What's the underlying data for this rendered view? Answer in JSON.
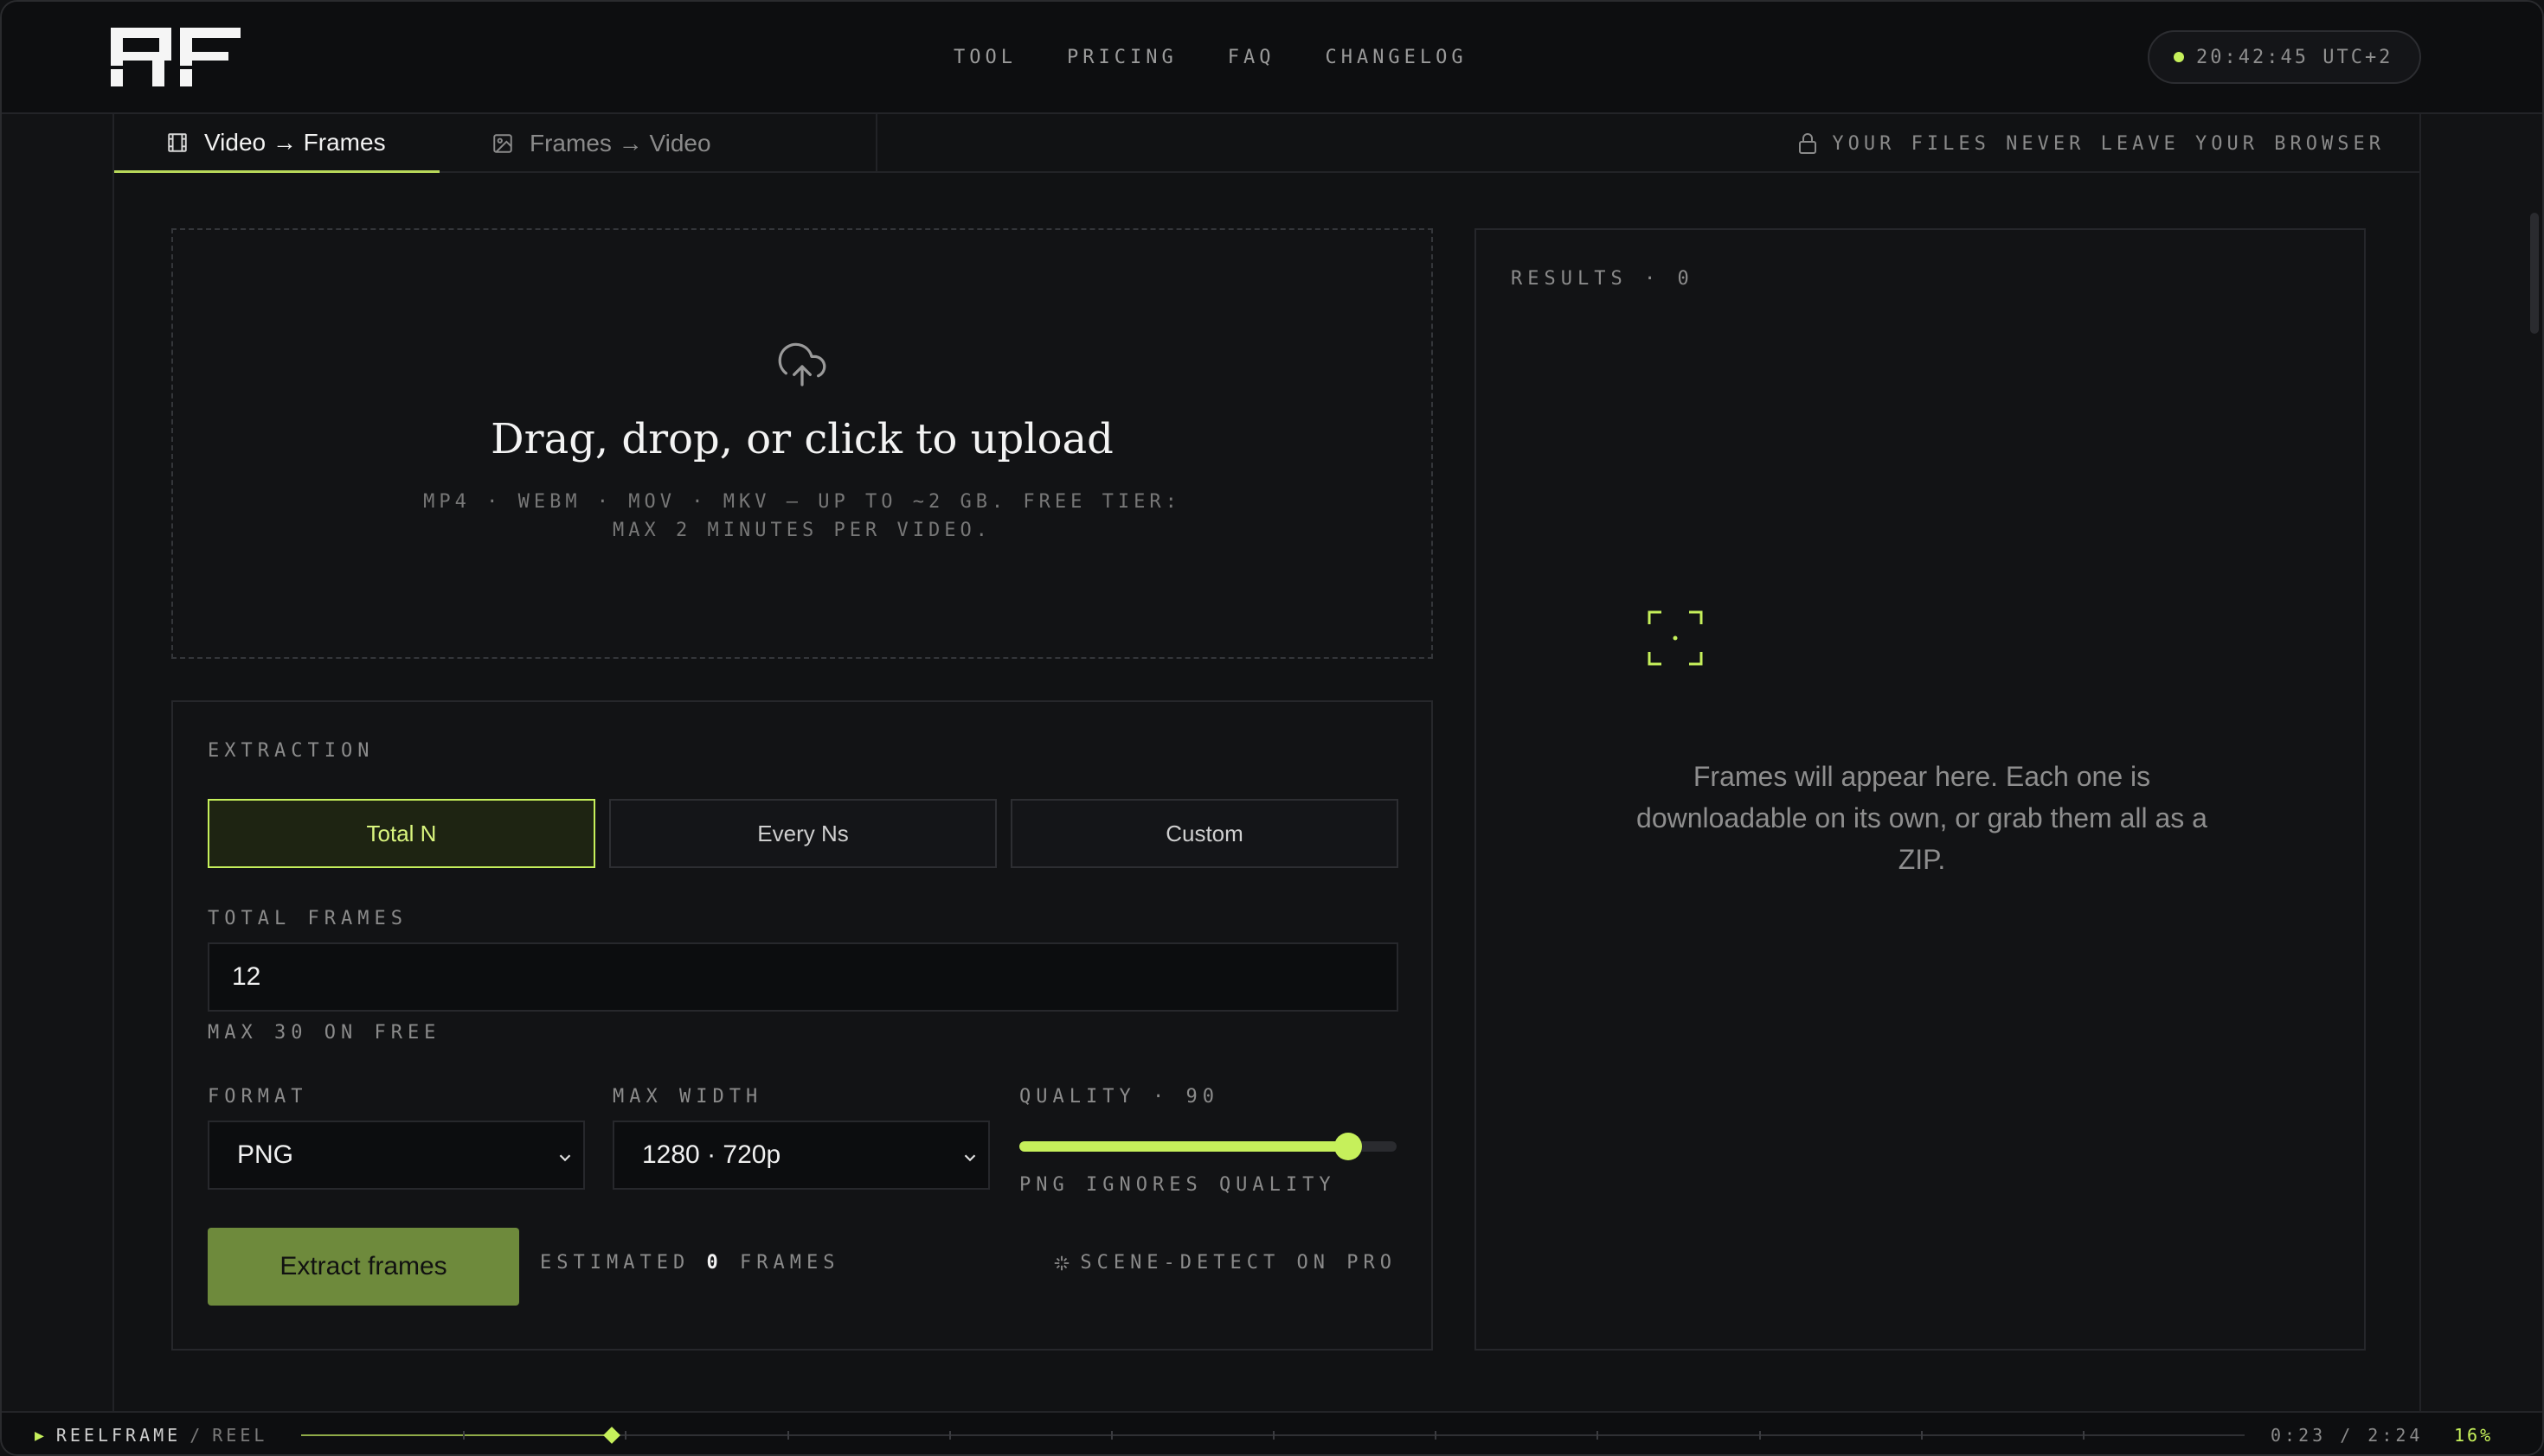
{
  "header": {
    "logo_text": "RF",
    "nav": [
      "TOOL",
      "PRICING",
      "FAQ",
      "CHANGELOG"
    ],
    "clock": "20:42:45 UTC+2"
  },
  "tabs": [
    {
      "label": "Video → Frames",
      "icon": "film-icon"
    },
    {
      "label": "Frames → Video",
      "icon": "image-icon"
    }
  ],
  "privacy_note": "YOUR FILES NEVER LEAVE YOUR BROWSER",
  "upload": {
    "title": "Drag, drop, or click to upload",
    "subtitle": "MP4 · WEBM · MOV · MKV — UP TO ~2 GB. FREE TIER: MAX 2 MINUTES PER VIDEO."
  },
  "extraction": {
    "section_label": "EXTRACTION",
    "modes": [
      "Total N",
      "Every Ns",
      "Custom"
    ],
    "selected_mode": "Total N",
    "total_frames_label": "TOTAL FRAMES",
    "total_frames_value": "12",
    "total_frames_hint": "MAX 30 ON FREE",
    "format_label": "FORMAT",
    "format_value": "PNG",
    "max_width_label": "MAX WIDTH",
    "max_width_value": "1280 · 720p",
    "quality_label": "QUALITY · 90",
    "quality_value": 90,
    "quality_hint": "PNG IGNORES QUALITY",
    "extract_button": "Extract frames",
    "estimated_prefix": "ESTIMATED",
    "estimated_count": "0",
    "estimated_suffix": "FRAMES",
    "scene_detect": "SCENE-DETECT ON PRO"
  },
  "results": {
    "label": "RESULTS · 0",
    "empty_text": "Frames will appear here. Each one is downloadable on its own, or grab them all as a ZIP."
  },
  "timeline": {
    "play_glyph": "▶",
    "brand": "REELFRAME",
    "separator": "/",
    "sub": "REEL",
    "time": "0:23 / 2:24",
    "progress_percent": "16%",
    "progress_fraction": 0.16
  },
  "colors": {
    "accent": "#c6f05b",
    "button": "#6e8a3c",
    "background": "#121315"
  }
}
